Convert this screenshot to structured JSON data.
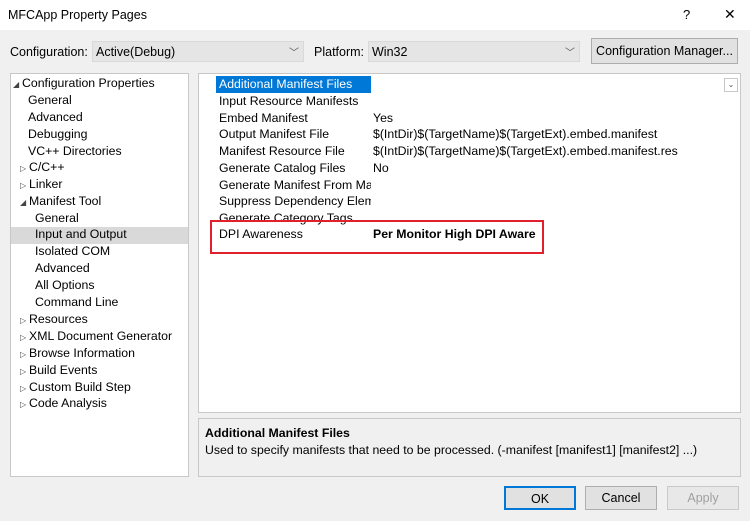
{
  "window": {
    "title": "MFCApp Property Pages",
    "help_glyph": "?",
    "close_glyph": "✕"
  },
  "config_bar": {
    "configuration_label": "Configuration:",
    "configuration_value": "Active(Debug)",
    "platform_label": "Platform:",
    "platform_value": "Win32",
    "config_manager_label": "Configuration Manager..."
  },
  "tree": {
    "items": [
      {
        "label": "Configuration Properties",
        "toggle": "◢"
      },
      {
        "label": "General",
        "toggle": ""
      },
      {
        "label": "Advanced",
        "toggle": ""
      },
      {
        "label": "Debugging",
        "toggle": ""
      },
      {
        "label": "VC++ Directories",
        "toggle": ""
      },
      {
        "label": "C/C++",
        "toggle": "▷"
      },
      {
        "label": "Linker",
        "toggle": "▷"
      },
      {
        "label": "Manifest Tool",
        "toggle": "◢"
      },
      {
        "label": "General",
        "toggle": ""
      },
      {
        "label": "Input and Output",
        "toggle": ""
      },
      {
        "label": "Isolated COM",
        "toggle": ""
      },
      {
        "label": "Advanced",
        "toggle": ""
      },
      {
        "label": "All Options",
        "toggle": ""
      },
      {
        "label": "Command Line",
        "toggle": ""
      },
      {
        "label": "Resources",
        "toggle": "▷"
      },
      {
        "label": "XML Document Generator",
        "toggle": "▷"
      },
      {
        "label": "Browse Information",
        "toggle": "▷"
      },
      {
        "label": "Build Events",
        "toggle": "▷"
      },
      {
        "label": "Custom Build Step",
        "toggle": "▷"
      },
      {
        "label": "Code Analysis",
        "toggle": "▷"
      }
    ]
  },
  "properties": {
    "rows": [
      {
        "name": "Additional Manifest Files",
        "value": ""
      },
      {
        "name": "Input Resource Manifests",
        "value": ""
      },
      {
        "name": "Embed Manifest",
        "value": "Yes"
      },
      {
        "name": "Output Manifest File",
        "value": "$(IntDir)$(TargetName)$(TargetExt).embed.manifest"
      },
      {
        "name": "Manifest Resource File",
        "value": "$(IntDir)$(TargetName)$(TargetExt).embed.manifest.res"
      },
      {
        "name": "Generate Catalog Files",
        "value": "No"
      },
      {
        "name": "Generate Manifest From ManagedAssembly",
        "value": ""
      },
      {
        "name": "Suppress Dependency Element",
        "value": ""
      },
      {
        "name": "Generate Category Tags",
        "value": ""
      },
      {
        "name": "DPI Awareness",
        "value": "Per Monitor High DPI Aware"
      }
    ],
    "dropdown_glyph": "⌄"
  },
  "description": {
    "title": "Additional Manifest Files",
    "text": "Used to specify manifests that need to be processed. (-manifest [manifest1] [manifest2] ...)"
  },
  "buttons": {
    "ok": "OK",
    "cancel": "Cancel",
    "apply": "Apply"
  },
  "colors": {
    "selection": "#0078d7",
    "highlight_border": "#e0202b",
    "disabled_text": "#a0a0a0"
  }
}
